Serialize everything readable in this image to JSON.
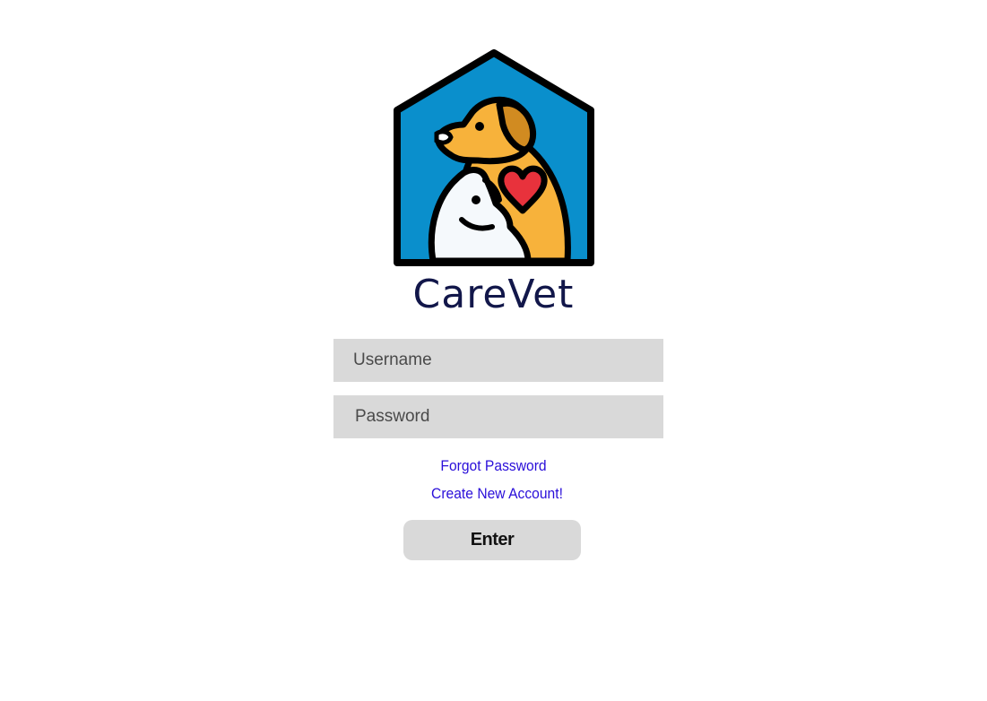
{
  "brand": {
    "name": "CareVet",
    "logo_icon": "pet-house-logo-icon",
    "colors": {
      "house_blue": "#0a8fcc",
      "dog_orange": "#f7b23b",
      "heart_red": "#e8323c",
      "brand_text": "#12174a"
    }
  },
  "login_form": {
    "username_placeholder": "Username",
    "password_placeholder": "Password",
    "forgot_password_label": "Forgot Password",
    "create_account_label": "Create New Account!",
    "enter_label": "Enter"
  }
}
